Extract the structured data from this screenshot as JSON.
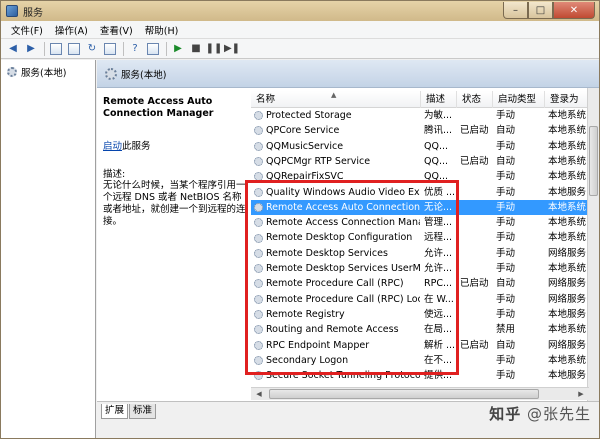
{
  "window": {
    "title": "服务"
  },
  "menu": [
    "文件(F)",
    "操作(A)",
    "查看(V)",
    "帮助(H)"
  ],
  "tree": {
    "root": "服务(本地)"
  },
  "pane": {
    "header": "服务(本地)"
  },
  "description": {
    "service_title": "Remote Access Auto Connection Manager",
    "action_link": "启动",
    "action_suffix": "此服务",
    "label": "描述:",
    "body": "无论什么时候，当某个程序引用一个远程 DNS 或者 NetBIOS 名称或者地址，就创建一个到远程的连接。"
  },
  "columns": {
    "name": "名称",
    "desc": "描述",
    "status": "状态",
    "startup": "启动类型",
    "logon": "登录为"
  },
  "rows": [
    {
      "name": "Protected Storage",
      "desc": "为敏...",
      "status": "",
      "startup": "手动",
      "logon": "本地系统"
    },
    {
      "name": "QPCore Service",
      "desc": "腾讯...",
      "status": "已启动",
      "startup": "自动",
      "logon": "本地系统"
    },
    {
      "name": "QQMusicService",
      "desc": "QQ...",
      "status": "",
      "startup": "手动",
      "logon": "本地系统"
    },
    {
      "name": "QQPCMgr RTP Service",
      "desc": "QQ...",
      "status": "已启动",
      "startup": "自动",
      "logon": "本地系统"
    },
    {
      "name": "QQRepairFixSVC",
      "desc": "QQ...",
      "status": "",
      "startup": "手动",
      "logon": "本地系统"
    },
    {
      "name": "Quality Windows Audio Video Ex...",
      "desc": "优质 ...",
      "status": "",
      "startup": "手动",
      "logon": "本地服务"
    },
    {
      "name": "Remote Access Auto Connection ...",
      "desc": "无论...",
      "status": "",
      "startup": "手动",
      "logon": "本地系统"
    },
    {
      "name": "Remote Access Connection Mana...",
      "desc": "管理...",
      "status": "",
      "startup": "手动",
      "logon": "本地系统"
    },
    {
      "name": "Remote Desktop Configuration",
      "desc": "远程...",
      "status": "",
      "startup": "手动",
      "logon": "本地系统"
    },
    {
      "name": "Remote Desktop Services",
      "desc": "允许...",
      "status": "",
      "startup": "手动",
      "logon": "网络服务"
    },
    {
      "name": "Remote Desktop Services UserM...",
      "desc": "允许...",
      "status": "",
      "startup": "手动",
      "logon": "本地系统"
    },
    {
      "name": "Remote Procedure Call (RPC)",
      "desc": "RPC...",
      "status": "已启动",
      "startup": "自动",
      "logon": "网络服务"
    },
    {
      "name": "Remote Procedure Call (RPC) Loc...",
      "desc": "在 W...",
      "status": "",
      "startup": "手动",
      "logon": "网络服务"
    },
    {
      "name": "Remote Registry",
      "desc": "使远...",
      "status": "",
      "startup": "手动",
      "logon": "本地服务"
    },
    {
      "name": "Routing and Remote Access",
      "desc": "在局...",
      "status": "",
      "startup": "禁用",
      "logon": "本地系统"
    },
    {
      "name": "RPC Endpoint Mapper",
      "desc": "解析 ...",
      "status": "已启动",
      "startup": "自动",
      "logon": "网络服务"
    },
    {
      "name": "Secondary Logon",
      "desc": "在不...",
      "status": "",
      "startup": "手动",
      "logon": "本地系统"
    },
    {
      "name": "Secure Socket Tunneling Protoco...",
      "desc": "提供...",
      "status": "",
      "startup": "手动",
      "logon": "本地服务"
    }
  ],
  "tabs": [
    "扩展",
    "标准"
  ],
  "watermark": {
    "logo": "知乎",
    "user": "@张先生"
  }
}
